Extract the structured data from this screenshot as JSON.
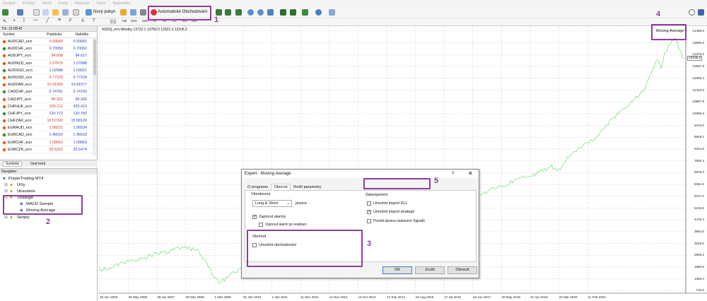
{
  "menubar": [
    "Soubor",
    "Pohled",
    "Vložit",
    "Grafy",
    "Nástroje",
    "Okno",
    "Nápověda"
  ],
  "toolbar": {
    "new_order": "Nový pokyn",
    "auto_trading": "Automatické Obchodování"
  },
  "timeframes": [
    "M1",
    "M5",
    "M15",
    "M30",
    "H1",
    "H4",
    "D1",
    "W1",
    "MN"
  ],
  "market_watch": {
    "title": "Trh: 16:08:42",
    "col_symbol": "Symbol",
    "col_bid": "Poptávka",
    "col_ask": "Nabídka",
    "rows": [
      {
        "s": "AUDCAD_ecn",
        "b": "0.93666",
        "a": "0.93681"
      },
      {
        "s": "AUDCHF_ecn",
        "b": "0.70050",
        "a": "0.70062"
      },
      {
        "s": "AUDJPY_ecn",
        "b": "84.608",
        "a": "84.617"
      },
      {
        "s": "AUDNZD_ecn",
        "b": "1.07675",
        "a": "1.07688"
      },
      {
        "s": "AUDSGD_ecn",
        "b": "1.02998",
        "a": "1.03021"
      },
      {
        "s": "AUDUSD_ecn",
        "b": "0.77229",
        "a": "0.77234"
      },
      {
        "s": "AUDZAR_ecn",
        "b": "10.91093",
        "a": "10.91577"
      },
      {
        "s": "CADCHF_ecn",
        "b": "0.74781",
        "a": "0.74793"
      },
      {
        "s": "CADJPY_ecn",
        "b": "90.321",
        "a": "90.330"
      },
      {
        "s": "CHFHUF_ecn",
        "b": "325.211",
        "a": "325.413"
      },
      {
        "s": "CHFJPY_ecn",
        "b": "120.772",
        "a": "120.783"
      },
      {
        "s": "CHFZAR_ecn",
        "b": "15.57292",
        "a": "15.58126"
      },
      {
        "s": "EURAUD_ecn",
        "b": "1.56521",
        "a": "1.56534"
      },
      {
        "s": "EURCAD_ecn",
        "b": "1.46619",
        "a": "1.46633"
      },
      {
        "s": "EURCHF_ecn",
        "b": "1.09652",
        "a": "1.09663"
      },
      {
        "s": "EURCZK_ecn",
        "b": "25.5312",
        "a": "25.5474"
      }
    ],
    "tab1": "Symboly",
    "tab2": "Graf ticků"
  },
  "navigator": {
    "title": "Navigátor",
    "root": "PurpleTrading MT4",
    "accounts": "Účty",
    "indicators": "Ukazatele",
    "strategies": "Strategie",
    "ea1": "MACD Sample",
    "ea2": "Moving Average",
    "scripts": "Skripty"
  },
  "chart": {
    "header": "NSDQ_ecn,Weekly  13722.1 13780.0 12922.3 13106.2",
    "ea_label": "Moving Average",
    "current_price": "13106.2",
    "y_ticks": [
      "14496.0",
      "13900.6",
      "13276.2",
      "12651.8",
      "12056.4",
      "11432.0",
      "10807.6",
      "10096.0",
      "9470.6",
      "8849.2",
      "8224.8",
      "7600.4",
      "6976.0",
      "6351.6",
      "5727.2",
      "5102.8",
      "4478.4",
      "3854.0",
      "3229.6",
      "2605.2",
      "1980.8",
      "1356.4",
      "732.0"
    ],
    "x_ticks": [
      "26 Jun 2005",
      "28 May 2006",
      "29 Apr 2007",
      "30 Mar 2008",
      "1 Mar 2009",
      "31 Jan 2010",
      "1 Jan 2011",
      "11 Dec 2011",
      "11 Nov 2012",
      "13 Oct 2013",
      "14 Sep 2014",
      "16 Aug 2015",
      "17 Jul 2016",
      "18 Jun 2017",
      "20 May 2018",
      "21 Apr 2019",
      "22 Mar 2020",
      "21 Feb 2021"
    ]
  },
  "annotations": [
    "1",
    "2",
    "3",
    "4",
    "5"
  ],
  "dialog": {
    "title": "Expert - Moving Average",
    "help": "?",
    "tabs": [
      "O programu",
      "Obecné",
      "Vložit parametry"
    ],
    "general_group": "Všeobecné",
    "position_select": "Long & Short",
    "position_label": "pozice",
    "enable_alerts": "Zapnout alarmy",
    "disable_alert": "Vypnout alarm po realizaci",
    "trade_group": "Obchod",
    "allow_trading": "Umožnit obchodování",
    "security_group": "Zabezpečení",
    "allow_dll": "Umožnit import DLL",
    "allow_import": "Umožnit import strategií",
    "allow_signals": "Povolit úpravu nastavení Signálů",
    "ok": "OK",
    "cancel": "Zrušit",
    "reset": "Obnovit"
  }
}
